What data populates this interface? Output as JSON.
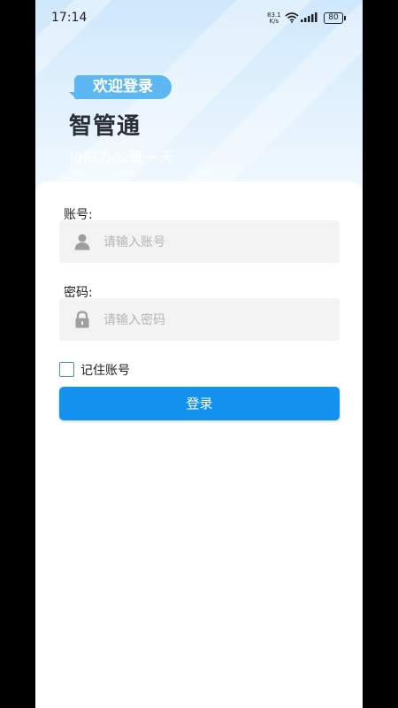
{
  "status_bar": {
    "time": "17:14",
    "net_speed_value": "83.1",
    "net_speed_unit": "K/s",
    "battery": "80"
  },
  "header": {
    "welcome_badge": "欢迎登录",
    "app_name": "智管通",
    "slogan": "协同办公每一天"
  },
  "form": {
    "account_label": "账号:",
    "account_placeholder": "请输入账号",
    "account_value": "",
    "password_label": "密码:",
    "password_placeholder": "请输入密码",
    "password_value": "",
    "remember_label": "记住账号",
    "remember_checked": false,
    "login_button": "登录"
  },
  "colors": {
    "accent": "#1492ef",
    "badge": "#5cb7f2",
    "header_gradient_top": "#cfe8fb",
    "field_bg": "#f3f3f3",
    "icon_gray": "#9e9e9e"
  },
  "icons": {
    "account_field": "person-icon",
    "password_field": "lock-icon",
    "status": [
      "wifi-icon",
      "signal-icon",
      "battery-icon"
    ]
  }
}
